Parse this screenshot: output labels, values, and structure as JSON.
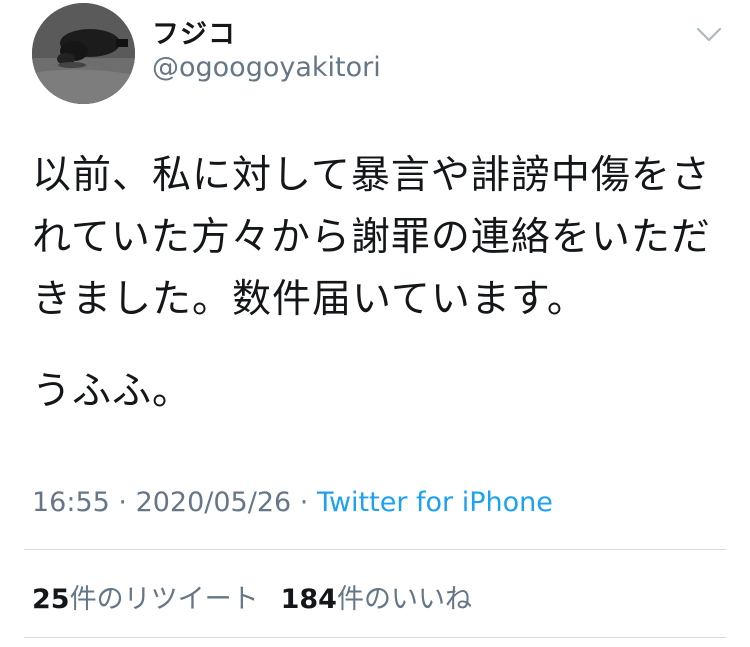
{
  "tweet": {
    "author": {
      "display_name": "フジコ",
      "handle": "@ogoogoyakitori"
    },
    "text_paragraph_1": "以前、私に対して暴言や誹謗中傷をされていた方々から謝罪の連絡をいただきました。数件届いています。",
    "text_paragraph_2": "うふふ。",
    "time": "16:55",
    "separator_1": " · ",
    "date": "2020/05/26",
    "separator_2": " · ",
    "source": "Twitter for iPhone",
    "retweets": {
      "count": "25",
      "label": "件のリツイート"
    },
    "likes": {
      "count": "184",
      "label": "件のいいね"
    },
    "menu_icon": "chevron-down-icon",
    "colors": {
      "link": "#1da1f2",
      "secondary_text": "#657786",
      "primary_text": "#14171a",
      "divider": "#d6dbe0"
    }
  }
}
